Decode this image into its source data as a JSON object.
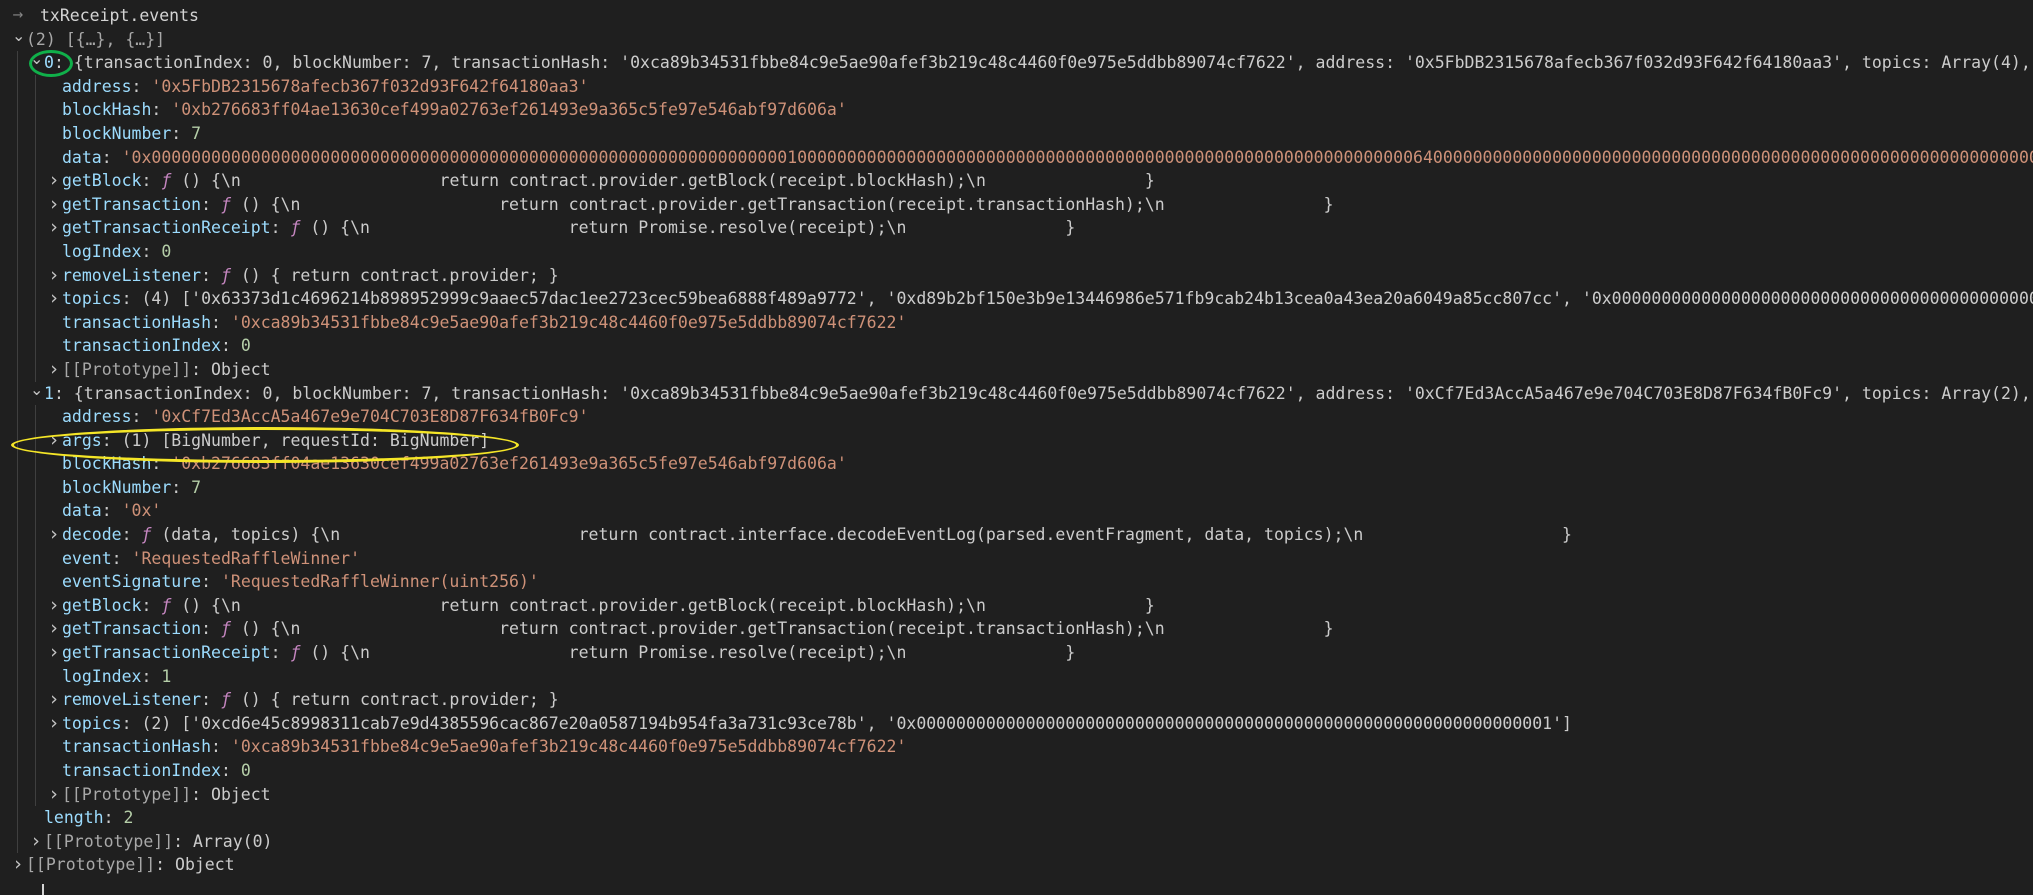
{
  "console": {
    "lines": [
      {
        "depth": 0,
        "prompt": true,
        "segments": [
          {
            "t": "txReceipt.events",
            "c": "cmd"
          }
        ]
      },
      {
        "depth": 0,
        "twisty": "open",
        "segments": [
          {
            "t": "(2) [{…}, {…}]",
            "c": "kp"
          }
        ]
      },
      {
        "depth": 1,
        "twisty": "open",
        "segments": [
          {
            "t": "0",
            "c": "k"
          },
          {
            "t": ": {transactionIndex: 0, blockNumber: 7, transactionHash: '0xca89b34531fbbe84c9e5ae90afef3b219c48c4460f0e975e5ddbb89074cf7622', address: '0x5FbDB2315678afecb367f032d93F642f64180aa3', topics: Array(4), …}"
          }
        ]
      },
      {
        "depth": 2,
        "segments": [
          {
            "t": "address",
            "c": "k"
          },
          {
            "t": ": "
          },
          {
            "t": "'0x5FbDB2315678afecb367f032d93F642f64180aa3'",
            "c": "s"
          }
        ]
      },
      {
        "depth": 2,
        "segments": [
          {
            "t": "blockHash",
            "c": "k"
          },
          {
            "t": ": "
          },
          {
            "t": "'0xb276683ff04ae13630cef499a02763ef261493e9a365c5fe97e546abf97d606a'",
            "c": "s"
          }
        ]
      },
      {
        "depth": 2,
        "segments": [
          {
            "t": "blockNumber",
            "c": "k"
          },
          {
            "t": ": "
          },
          {
            "t": "7",
            "c": "n"
          }
        ]
      },
      {
        "depth": 2,
        "segments": [
          {
            "t": "data",
            "c": "k"
          },
          {
            "t": ": "
          },
          {
            "t": "'0x00000000000000000000000000000000000000000000000000000000000000001000000000000000000000000000000000000000000000000000000000000006400000000000000000000000000000000000000000000000000000000000003000000000",
            "c": "s"
          }
        ]
      },
      {
        "depth": 2,
        "twisty": "closed",
        "segments": [
          {
            "t": "getBlock",
            "c": "k"
          },
          {
            "t": ": "
          },
          {
            "t": "ƒ",
            "c": "f"
          },
          {
            "t": " () {\\n                    return contract.provider.getBlock(receipt.blockHash);\\n                }"
          }
        ]
      },
      {
        "depth": 2,
        "twisty": "closed",
        "segments": [
          {
            "t": "getTransaction",
            "c": "k"
          },
          {
            "t": ": "
          },
          {
            "t": "ƒ",
            "c": "f"
          },
          {
            "t": " () {\\n                    return contract.provider.getTransaction(receipt.transactionHash);\\n                }"
          }
        ]
      },
      {
        "depth": 2,
        "twisty": "closed",
        "segments": [
          {
            "t": "getTransactionReceipt",
            "c": "k"
          },
          {
            "t": ": "
          },
          {
            "t": "ƒ",
            "c": "f"
          },
          {
            "t": " () {\\n                    return Promise.resolve(receipt);\\n                }"
          }
        ]
      },
      {
        "depth": 2,
        "segments": [
          {
            "t": "logIndex",
            "c": "k"
          },
          {
            "t": ": "
          },
          {
            "t": "0",
            "c": "n"
          }
        ]
      },
      {
        "depth": 2,
        "twisty": "closed",
        "segments": [
          {
            "t": "removeListener",
            "c": "k"
          },
          {
            "t": ": "
          },
          {
            "t": "ƒ",
            "c": "f"
          },
          {
            "t": " () { return contract.provider; }"
          }
        ]
      },
      {
        "depth": 2,
        "twisty": "closed",
        "segments": [
          {
            "t": "topics",
            "c": "k"
          },
          {
            "t": ": (4) ['0x63373d1c4696214b898952999c9aaec57dac1ee2723cec59bea6888f489a9772', '0xd89b2bf150e3b9e13446986e571fb9cab24b13cea0a43ea20a6049a85cc807cc', '0x000000000000000000000000000000000000000000000000000000000000000"
          }
        ]
      },
      {
        "depth": 2,
        "segments": [
          {
            "t": "transactionHash",
            "c": "k"
          },
          {
            "t": ": "
          },
          {
            "t": "'0xca89b34531fbbe84c9e5ae90afef3b219c48c4460f0e975e5ddbb89074cf7622'",
            "c": "s"
          }
        ]
      },
      {
        "depth": 2,
        "segments": [
          {
            "t": "transactionIndex",
            "c": "k"
          },
          {
            "t": ": "
          },
          {
            "t": "0",
            "c": "n"
          }
        ]
      },
      {
        "depth": 2,
        "twisty": "closed",
        "segments": [
          {
            "t": "[[Prototype]]",
            "c": "kp"
          },
          {
            "t": ": Object"
          }
        ]
      },
      {
        "depth": 1,
        "twisty": "open",
        "segments": [
          {
            "t": "1",
            "c": "k"
          },
          {
            "t": ": {transactionIndex: 0, blockNumber: 7, transactionHash: '0xca89b34531fbbe84c9e5ae90afef3b219c48c4460f0e975e5ddbb89074cf7622', address: '0xCf7Ed3AccA5a467e9e704C703E8D87F634fB0Fc9', topics: Array(2), …}"
          }
        ]
      },
      {
        "depth": 2,
        "segments": [
          {
            "t": "address",
            "c": "k"
          },
          {
            "t": ": "
          },
          {
            "t": "'0xCf7Ed3AccA5a467e9e704C703E8D87F634fB0Fc9'",
            "c": "s"
          }
        ]
      },
      {
        "depth": 2,
        "twisty": "closed",
        "segments": [
          {
            "t": "args",
            "c": "k"
          },
          {
            "t": ": (1) [BigNumber, requestId: BigNumber]"
          }
        ]
      },
      {
        "depth": 2,
        "segments": [
          {
            "t": "blockHash",
            "c": "k"
          },
          {
            "t": ": "
          },
          {
            "t": "'0xb276683ff04ae13630cef499a02763ef261493e9a365c5fe97e546abf97d606a'",
            "c": "s"
          }
        ]
      },
      {
        "depth": 2,
        "segments": [
          {
            "t": "blockNumber",
            "c": "k"
          },
          {
            "t": ": "
          },
          {
            "t": "7",
            "c": "n"
          }
        ]
      },
      {
        "depth": 2,
        "segments": [
          {
            "t": "data",
            "c": "k"
          },
          {
            "t": ": "
          },
          {
            "t": "'0x'",
            "c": "s"
          }
        ]
      },
      {
        "depth": 2,
        "twisty": "closed",
        "segments": [
          {
            "t": "decode",
            "c": "k"
          },
          {
            "t": ": "
          },
          {
            "t": "ƒ",
            "c": "f"
          },
          {
            "t": " (data, topics) {\\n                        return contract.interface.decodeEventLog(parsed.eventFragment, data, topics);\\n                    }"
          }
        ]
      },
      {
        "depth": 2,
        "segments": [
          {
            "t": "event",
            "c": "k"
          },
          {
            "t": ": "
          },
          {
            "t": "'RequestedRaffleWinner'",
            "c": "s"
          }
        ]
      },
      {
        "depth": 2,
        "segments": [
          {
            "t": "eventSignature",
            "c": "k"
          },
          {
            "t": ": "
          },
          {
            "t": "'RequestedRaffleWinner(uint256)'",
            "c": "s"
          }
        ]
      },
      {
        "depth": 2,
        "twisty": "closed",
        "segments": [
          {
            "t": "getBlock",
            "c": "k"
          },
          {
            "t": ": "
          },
          {
            "t": "ƒ",
            "c": "f"
          },
          {
            "t": " () {\\n                    return contract.provider.getBlock(receipt.blockHash);\\n                }"
          }
        ]
      },
      {
        "depth": 2,
        "twisty": "closed",
        "segments": [
          {
            "t": "getTransaction",
            "c": "k"
          },
          {
            "t": ": "
          },
          {
            "t": "ƒ",
            "c": "f"
          },
          {
            "t": " () {\\n                    return contract.provider.getTransaction(receipt.transactionHash);\\n                }"
          }
        ]
      },
      {
        "depth": 2,
        "twisty": "closed",
        "segments": [
          {
            "t": "getTransactionReceipt",
            "c": "k"
          },
          {
            "t": ": "
          },
          {
            "t": "ƒ",
            "c": "f"
          },
          {
            "t": " () {\\n                    return Promise.resolve(receipt);\\n                }"
          }
        ]
      },
      {
        "depth": 2,
        "segments": [
          {
            "t": "logIndex",
            "c": "k"
          },
          {
            "t": ": "
          },
          {
            "t": "1",
            "c": "n"
          }
        ]
      },
      {
        "depth": 2,
        "twisty": "closed",
        "segments": [
          {
            "t": "removeListener",
            "c": "k"
          },
          {
            "t": ": "
          },
          {
            "t": "ƒ",
            "c": "f"
          },
          {
            "t": " () { return contract.provider; }"
          }
        ]
      },
      {
        "depth": 2,
        "twisty": "closed",
        "segments": [
          {
            "t": "topics",
            "c": "k"
          },
          {
            "t": ": (2) ['0xcd6e45c8998311cab7e9d4385596cac867e20a0587194b954fa3a731c93ce78b', '0x0000000000000000000000000000000000000000000000000000000000000001']"
          }
        ]
      },
      {
        "depth": 2,
        "segments": [
          {
            "t": "transactionHash",
            "c": "k"
          },
          {
            "t": ": "
          },
          {
            "t": "'0xca89b34531fbbe84c9e5ae90afef3b219c48c4460f0e975e5ddbb89074cf7622'",
            "c": "s"
          }
        ]
      },
      {
        "depth": 2,
        "segments": [
          {
            "t": "transactionIndex",
            "c": "k"
          },
          {
            "t": ": "
          },
          {
            "t": "0",
            "c": "n"
          }
        ]
      },
      {
        "depth": 2,
        "twisty": "closed",
        "segments": [
          {
            "t": "[[Prototype]]",
            "c": "kp"
          },
          {
            "t": ": Object"
          }
        ]
      },
      {
        "depth": 1,
        "segments": [
          {
            "t": "length",
            "c": "k"
          },
          {
            "t": ": "
          },
          {
            "t": "2",
            "c": "n"
          }
        ]
      },
      {
        "depth": 1,
        "twisty": "closed",
        "segments": [
          {
            "t": "[[Prototype]]",
            "c": "kp"
          },
          {
            "t": ": Array(0)"
          }
        ]
      },
      {
        "depth": 0,
        "twisty": "closed",
        "segments": [
          {
            "t": "[[Prototype]]",
            "c": "kp"
          },
          {
            "t": ": Object"
          }
        ]
      }
    ]
  },
  "icons": {
    "prompt": "chevron-right-icon",
    "expanded": "chevron-down-icon",
    "collapsed": "chevron-right-icon"
  },
  "colors": {
    "background": "#1f1f1f",
    "key": "#9cdcfe",
    "string": "#ce9178",
    "number": "#b5cea8",
    "function": "#c586c0",
    "annotation_green": "#10b04a",
    "annotation_yellow": "#f5e627"
  }
}
